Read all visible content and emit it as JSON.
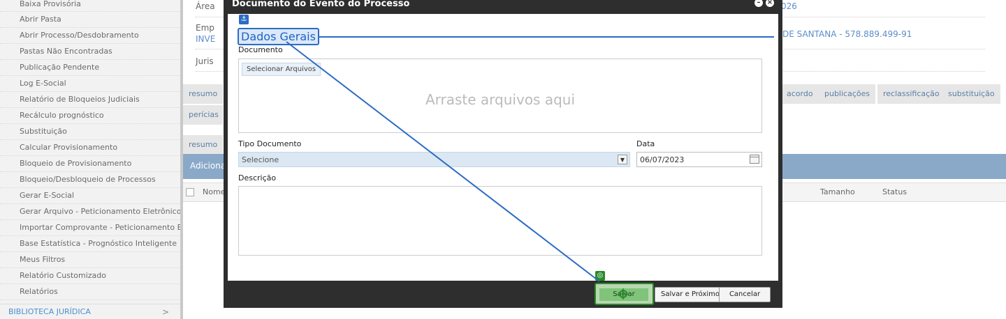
{
  "sidebar": {
    "items": [
      {
        "label": "Baixa Provisória"
      },
      {
        "label": "Abrir Pasta"
      },
      {
        "label": "Abrir Processo/Desdobramento"
      },
      {
        "label": "Pastas Não Encontradas"
      },
      {
        "label": "Publicação Pendente"
      },
      {
        "label": "Log E-Social"
      },
      {
        "label": "Relatório de Bloqueios Judiciais"
      },
      {
        "label": "Recálculo prognóstico"
      },
      {
        "label": "Substituição"
      },
      {
        "label": "Calcular Provisionamento"
      },
      {
        "label": "Bloqueio de Provisionamento"
      },
      {
        "label": "Bloqueio/Desbloqueio de Processos"
      },
      {
        "label": "Gerar E-Social"
      },
      {
        "label": "Gerar Arquivo - Peticionamento Eletrônico"
      },
      {
        "label": "Importar Comprovante - Peticionamento Eletr"
      },
      {
        "label": "Base Estatística - Prognóstico Inteligente"
      },
      {
        "label": "Meus Filtros"
      },
      {
        "label": "Relatório Customizado"
      },
      {
        "label": "Relatórios"
      }
    ],
    "section": {
      "label": "BIBLIOTECA JURÍDICA",
      "chevron": ">"
    }
  },
  "main": {
    "area_label": "Área",
    "area_value": "026",
    "emp_label": "Emp",
    "emp_value": "INVE",
    "emp_right": "DE SANTANA - 578.889.499-91",
    "juris_label": "Juris",
    "tabs_row1": [
      "resumo",
      "acordo",
      "publicações",
      "reclassificação",
      "substituição"
    ],
    "tabs_row2": [
      "perícias"
    ],
    "tabs_row3": [
      "resumo"
    ],
    "add_label": "Adiciona",
    "table_headers": {
      "nome": "Nome",
      "tamanho": "Tamanho",
      "status": "Status"
    }
  },
  "modal": {
    "title": "Documento do Evento do Processo",
    "section_title": "Dados Gerais",
    "anchor_icon": "anchor-icon",
    "documento_label": "Documento",
    "select_files_label": "Selecionar Arquivos",
    "dropzone_text": "Arraste arquivos aqui",
    "tipo_label": "Tipo Documento",
    "tipo_value": "Selecione",
    "data_label": "Data",
    "data_value": "06/07/2023",
    "descricao_label": "Descrição",
    "buttons": {
      "save": "Salvar",
      "save_next": "Salvar e Próximo",
      "cancel": "Cancelar"
    }
  },
  "colors": {
    "annotation_blue": "#2b6cc4",
    "annotation_green": "#2a8a2a",
    "link_blue": "#5b8dc9",
    "bar_blue": "#8aa9c9"
  }
}
